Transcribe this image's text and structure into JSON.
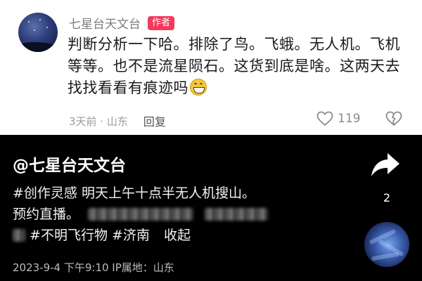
{
  "comment": {
    "author_name": "七星台天文台",
    "author_badge": "作者",
    "text": "判断分析一下哈。排除了鸟。飞蛾。无人机。飞机等等。也不是流星陨石。这货到底是啥。这两天去找找看看有痕迹吗",
    "emoji": "grin-emoji",
    "time_location": "3天前 · 山东",
    "reply_label": "回复",
    "like_count": "119"
  },
  "post": {
    "account_handle": "@七星台天文台",
    "tag_creation": "#创作灵感",
    "caption_line1": "明天上午十点半无人机搜山。",
    "caption_line2": "预约直播。",
    "tag_ufo": "#不明飞行物",
    "tag_jinan": "#济南",
    "collapse_label": "收起",
    "meta": "2023-9-4 下午9:10  IP属地：山东",
    "share_count": "2"
  },
  "icons": {
    "share": "share-arrow-icon",
    "like": "heart-outline-icon",
    "dislike": "broken-heart-icon",
    "avatar_top": "author-avatar-image",
    "avatar_bottom": "account-avatar-image"
  },
  "colors": {
    "badge": "#f23a5a",
    "comment_bg": "#ffffff",
    "video_bg": "#000000"
  }
}
